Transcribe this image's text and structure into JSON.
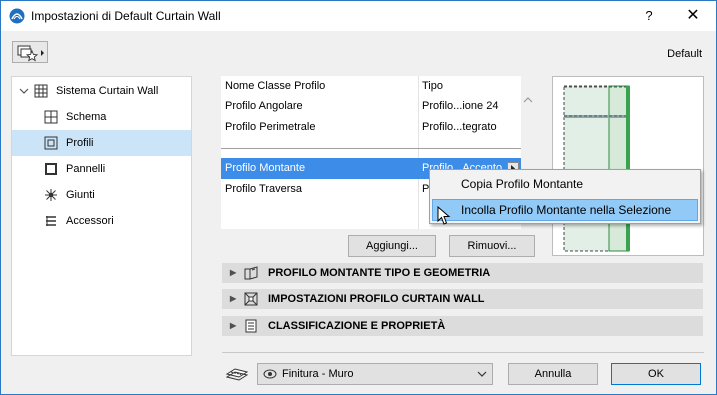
{
  "window": {
    "title": "Impostazioni di Default Curtain Wall",
    "help": "?",
    "close": "✕"
  },
  "header": {
    "default_label": "Default"
  },
  "tree": {
    "root": "Sistema Curtain Wall",
    "items": [
      {
        "label": "Schema"
      },
      {
        "label": "Profili"
      },
      {
        "label": "Pannelli"
      },
      {
        "label": "Giunti"
      },
      {
        "label": "Accessori"
      }
    ]
  },
  "profile_list": {
    "header": {
      "name": "Nome Classe Profilo",
      "type": "Tipo"
    },
    "rows": [
      {
        "name": "Profilo Angolare",
        "type": "Profilo...ione 24"
      },
      {
        "name": "Profilo Perimetrale",
        "type": "Profilo...tegrato"
      },
      {
        "name": "Profilo Montante",
        "type": "Profilo...Accento"
      },
      {
        "name": "Profilo Traversa",
        "type": "P"
      }
    ]
  },
  "buttons": {
    "add": "Aggiungi...",
    "remove": "Rimuovi...",
    "cancel": "Annulla",
    "ok": "OK"
  },
  "sections": [
    {
      "label": "PROFILO MONTANTE TIPO E GEOMETRIA"
    },
    {
      "label": "IMPOSTAZIONI PROFILO CURTAIN WALL"
    },
    {
      "label": "CLASSIFICAZIONE E PROPRIETÀ"
    }
  ],
  "finish": {
    "selected": "Finitura - Muro"
  },
  "context_menu": {
    "items": [
      {
        "label": "Copia Profilo Montante"
      },
      {
        "label": "Incolla Profilo Montante nella Selezione"
      }
    ]
  }
}
